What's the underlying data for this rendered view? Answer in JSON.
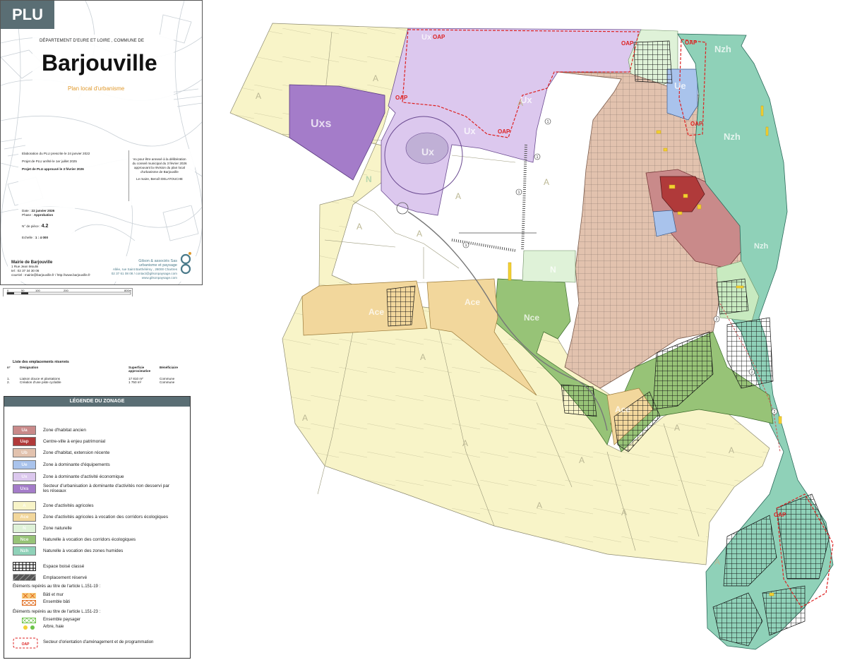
{
  "tag": "PLU",
  "title_block": {
    "department": "DÉPARTEMENT D'EURE ET LOIRE , COMMUNE DE",
    "town": "Barjouville",
    "subtitle": "Plan local d'urbanisme",
    "milestones": [
      "Elaboration du PLU prescrite le 24 janvier 2022",
      "Projet de PLU arrêté le 1er juillet 2025",
      "Projet de PLU approuvé le 3 février 2026"
    ],
    "annex_text": "Vu pour être annexé à la délibération du conseil municipal du 3 février 2026 approuvant la révision du plan local d'urbanisme de Barjouville",
    "mayor": "Le maire, Benoît DELATOUCHE",
    "date_label": "Date :",
    "date_value": "22 janvier 2026",
    "phase_label": "Phase :",
    "phase_value": "Approbation",
    "piece_label": "N° de pièce :",
    "piece_value": "4.2",
    "scale_label": "Echelle :",
    "scale_value": "1 : 4 000",
    "mairie_name": "Mairie de Barjouville",
    "mairie_address": "1 Rue Jean Moulin",
    "mairie_tel": "tel : 02 37 34 30 06",
    "mairie_contact": "courriel : mairie@barjouville.fr / http://www.barjouville.fr",
    "bureau_name": "Gilson & associés Sas",
    "bureau_sub": "urbanisme et paysage",
    "bureau_address": "Allée, rue Saint Barthélémy , 28000 Chartres",
    "bureau_contact": "02 37 61 08 08 / contact@gilsonpaysage.com",
    "bureau_web": "www.gilsonpaysage.com"
  },
  "scalebar": {
    "ticks": [
      "0",
      "50",
      "100",
      "200",
      "",
      "",
      "",
      "800m"
    ]
  },
  "reserved": {
    "title": "Liste des emplacements réservés",
    "headers": [
      "n°",
      "Désignation",
      "Superficie approximative",
      "Bénéficiaire"
    ],
    "rows": [
      [
        "1.",
        "Liaison douce et plantations",
        "17 810 m²",
        "Commune"
      ],
      [
        "2.",
        "Création d'une piste cyclable",
        "1 750 m²",
        "Commune"
      ]
    ]
  },
  "legend": {
    "title": "LÉGENDE DU ZONAGE",
    "urban": [
      {
        "code": "Ua",
        "label": "Zone d'habitat ancien",
        "color": "#c98a8a"
      },
      {
        "code": "Uap",
        "label": "Centre-ville à enjeu patrimonial",
        "color": "#b03a3a"
      },
      {
        "code": "Ub",
        "label": "Zone d'habitat, extension récente",
        "color": "#e2c2ae"
      },
      {
        "code": "Ue",
        "label": "Zone à dominante d'équipements",
        "color": "#a9c3ec"
      },
      {
        "code": "Ux",
        "label": "Zone à dominante d'activité économique",
        "color": "#dcc8ee"
      },
      {
        "code": "Uxs",
        "label": "Secteur d'urbanisation à dominante d'activités non desservi par les réseaux",
        "color": "#a47cc9"
      }
    ],
    "natural": [
      {
        "code": "A",
        "label": "Zone d'activités agricoles",
        "color": "#f8f4c8"
      },
      {
        "code": "Ace",
        "label": "Zone d'activités agricoles à vocation des corridors écologiques",
        "color": "#f2d79c"
      },
      {
        "code": "N",
        "label": "Zone naturelle",
        "color": "#dff2d8"
      },
      {
        "code": "Nce",
        "label": "Naturelle à vocation des corridors écologiques",
        "color": "#97c377"
      },
      {
        "code": "Nzh",
        "label": "Naturelle à vocation des zones humides",
        "color": "#8fd1b8"
      }
    ],
    "ebc_label": "Espace boisé classé",
    "er_label": "Emplacement réservé",
    "art19_title": "Éléments repérés au titre de l'article L.151-19 :",
    "art19_items": [
      "Bâti et mur",
      "Ensemble bâti"
    ],
    "art23_title": "Éléments repérés au titre de l'article L.151-23 :",
    "art23_items": [
      "Ensemble paysager",
      "Arbre, haie"
    ],
    "oap_code": "OAP",
    "oap_label": "Secteur d'orientation d'aménagement et de programmation"
  },
  "map": {
    "zone_labels": [
      "Ux",
      "Uxs",
      "Ux",
      "Ux",
      "Ux",
      "Ue",
      "Nzh",
      "Nzh",
      "Nzh",
      "A",
      "A",
      "A",
      "A",
      "A",
      "A",
      "A",
      "A",
      "A",
      "A",
      "A",
      "A",
      "A",
      "N",
      "N",
      "Ace",
      "Ace",
      "Nce",
      "Ace",
      "A",
      "A",
      "A"
    ],
    "oap_labels": [
      "OAP",
      "OAP",
      "OAP",
      "OAP",
      "OAP",
      "OAP",
      "OAP"
    ],
    "markers": [
      "1",
      "1",
      "1",
      "1",
      "2",
      "2",
      "2"
    ]
  }
}
